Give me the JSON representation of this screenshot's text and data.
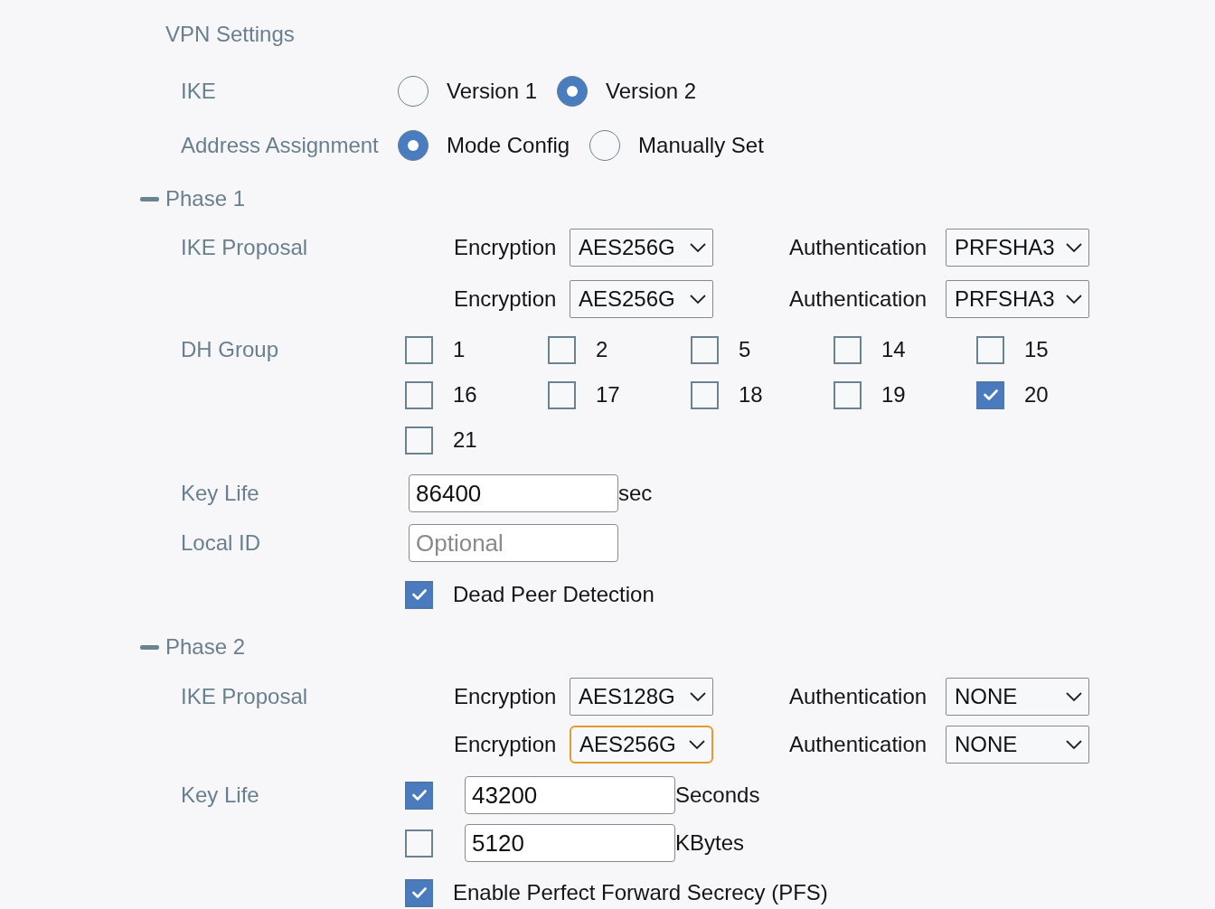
{
  "section_title": "VPN Settings",
  "general": [
    {
      "label": "IKE",
      "options": [
        {
          "label": "Version 1",
          "selected": false
        },
        {
          "label": "Version 2",
          "selected": true
        }
      ]
    },
    {
      "label": "Address Assignment",
      "options": [
        {
          "label": "Mode Config",
          "selected": true
        },
        {
          "label": "Manually Set",
          "selected": false
        }
      ]
    }
  ],
  "phase_1": {
    "title": "Phase 1",
    "expanded": true,
    "ike_proposal": {
      "label": "IKE Proposal",
      "rows": [
        {
          "encryption": {
            "label": "Encryption",
            "value": "AES256G",
            "focused": false
          },
          "authentication": {
            "label": "Authentication",
            "value": "PRFSHA3",
            "focused": false
          }
        },
        {
          "encryption": {
            "label": "Encryption",
            "value": "AES256G",
            "focused": false
          },
          "authentication": {
            "label": "Authentication",
            "value": "PRFSHA3",
            "focused": false
          }
        }
      ]
    },
    "dh_group": {
      "label": "DH Group",
      "options": [
        {
          "label": "1",
          "checked": false
        },
        {
          "label": "2",
          "checked": false
        },
        {
          "label": "5",
          "checked": false
        },
        {
          "label": "14",
          "checked": false
        },
        {
          "label": "15",
          "checked": false
        },
        {
          "label": "16",
          "checked": false
        },
        {
          "label": "17",
          "checked": false
        },
        {
          "label": "18",
          "checked": false
        },
        {
          "label": "19",
          "checked": false
        },
        {
          "label": "20",
          "checked": true
        },
        {
          "label": "21",
          "checked": false
        }
      ]
    },
    "key_life": {
      "label": "Key Life",
      "value": "86400",
      "unit": "sec"
    },
    "local_id": {
      "label": "Local ID",
      "placeholder": "Optional"
    },
    "dead_peer_detection": {
      "label": "Dead Peer Detection",
      "checked": true
    }
  },
  "phase_2": {
    "title": "Phase 2",
    "expanded": true,
    "ike_proposal": {
      "label": "IKE Proposal",
      "rows": [
        {
          "encryption": {
            "label": "Encryption",
            "value": "AES128G",
            "focused": false
          },
          "authentication": {
            "label": "Authentication",
            "value": "NONE",
            "focused": false
          }
        },
        {
          "encryption": {
            "label": "Encryption",
            "value": "AES256G",
            "focused": true
          },
          "authentication": {
            "label": "Authentication",
            "value": "NONE",
            "focused": false
          }
        }
      ]
    },
    "key_life": {
      "label": "Key Life",
      "limits": [
        {
          "checked": true,
          "value": "43200",
          "unit": "Seconds"
        },
        {
          "checked": false,
          "value": "5120",
          "unit": "KBytes"
        }
      ]
    },
    "pfs": {
      "label": "Enable Perfect Forward Secrecy (PFS)",
      "checked": true
    }
  }
}
